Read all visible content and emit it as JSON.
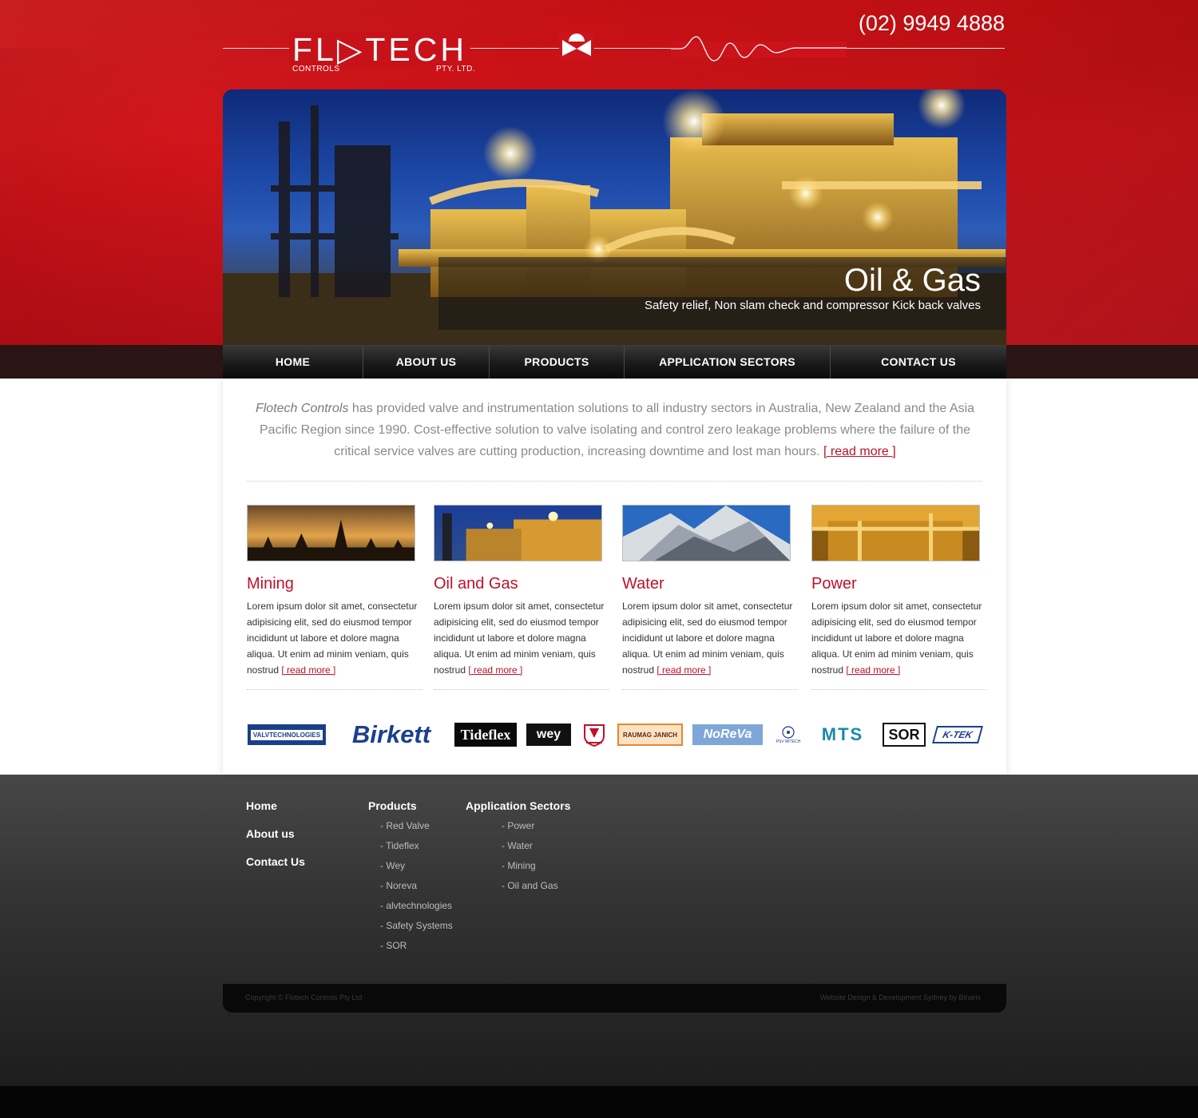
{
  "header": {
    "logo": {
      "word": "FL▷TECH",
      "sub_left": "CONTROLS",
      "sub_right": "PTY. LTD."
    },
    "phone": "(02) 9949 4888"
  },
  "hero": {
    "title": "Oil & Gas",
    "subtitle": "Safety relief, Non slam check and compressor Kick back valves"
  },
  "nav": [
    "HOME",
    "ABOUT US",
    "PRODUCTS",
    "APPLICATION SECTORS",
    "CONTACT US"
  ],
  "intro": {
    "company": "Flotech Controls",
    "text": " has provided valve and instrumentation solutions to all industry sectors in Australia, New Zealand and the Asia Pacific Region since 1990. Cost-effective solution to valve isolating and control zero leakage problems where the failure of the critical service valves are cutting production, increasing downtime and lost man hours. ",
    "read_more": "[ read more ]"
  },
  "sectors": [
    {
      "title": "Mining",
      "text": "Lorem ipsum dolor sit amet, consectetur adipisicing elit, sed do eiusmod tempor incididunt ut labore et dolore magna aliqua. Ut enim ad minim veniam, quis nostrud ",
      "read_more": "[ read more ]"
    },
    {
      "title": "Oil and Gas",
      "text": "Lorem ipsum dolor sit amet, consectetur adipisicing elit, sed do eiusmod tempor incididunt ut labore et dolore magna aliqua. Ut enim ad minim veniam, quis nostrud ",
      "read_more": "[ read more ]"
    },
    {
      "title": "Water",
      "text": "Lorem ipsum dolor sit amet, consectetur adipisicing elit, sed do eiusmod tempor incididunt ut labore et dolore magna aliqua. Ut enim ad minim veniam, quis nostrud ",
      "read_more": "[ read more ]"
    },
    {
      "title": "Power",
      "text": "Lorem ipsum dolor sit amet, consectetur adipisicing elit, sed do eiusmod tempor incididunt ut labore et dolore magna aliqua. Ut enim ad minim veniam, quis nostrud ",
      "read_more": "[ read more ]"
    }
  ],
  "brands": [
    "VALVTECHNOLOGIES",
    "Birkett",
    "Tideflex",
    "wey",
    "",
    "RAUMAG JANICH",
    "NoReVa",
    "PSV MITECH",
    "MTS",
    "SOR",
    "K-TEK"
  ],
  "footer": {
    "main_links": [
      "Home",
      "About us",
      "Contact Us"
    ],
    "products_heading": "Products",
    "products": [
      "- Red Valve",
      "- Tideflex",
      "- Wey",
      "- Noreva",
      "- alvtechnologies",
      "- Safety Systems",
      "- SOR"
    ],
    "sectors_heading": "Application Sectors",
    "sectors": [
      "- Power",
      "- Water",
      "- Mining",
      "- Oil and Gas"
    ],
    "copyright": "Copyright © Flotech Controls Pty Ltd",
    "credit": "Website Design & Development Sydney by Binarix"
  },
  "colors": {
    "brand_red": "#c8121a",
    "link_red": "#b8122a",
    "heading_red": "#c0102a"
  }
}
